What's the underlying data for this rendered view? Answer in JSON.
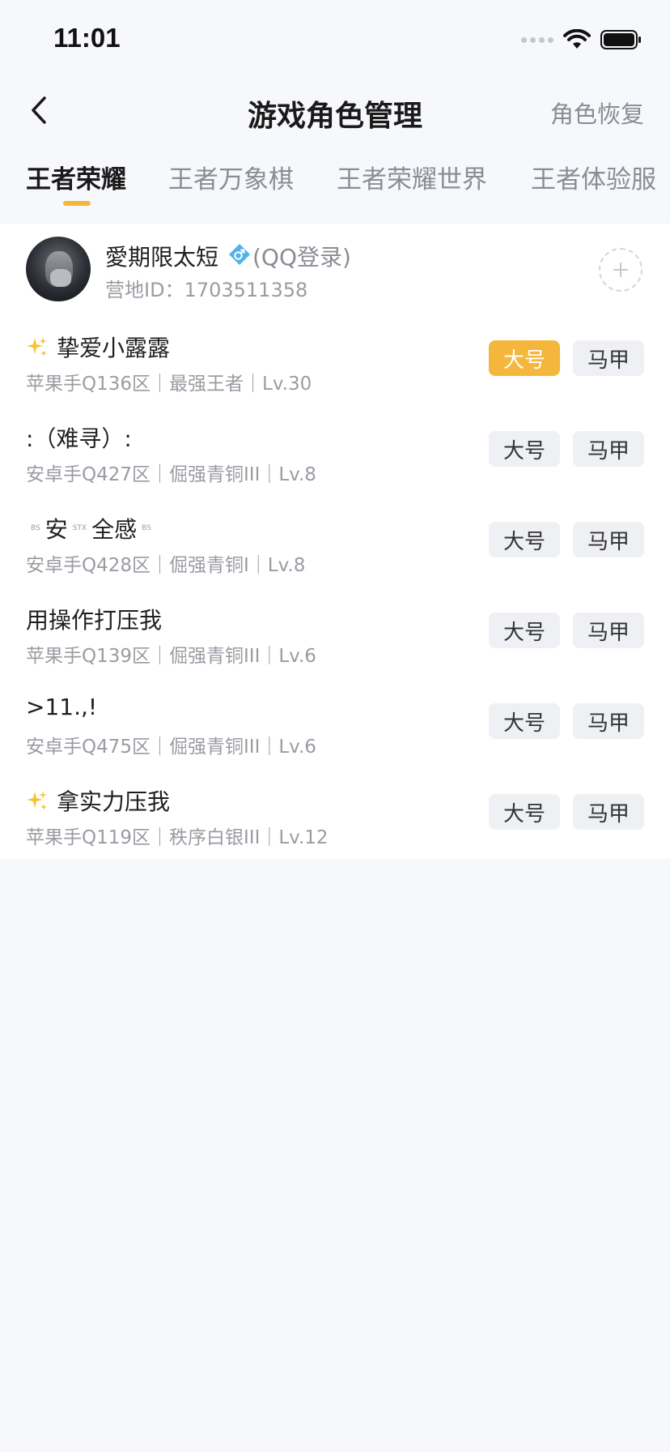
{
  "status_bar": {
    "time": "11:01",
    "icons": [
      "cellular-signal-icon",
      "wifi-icon",
      "battery-icon"
    ]
  },
  "nav": {
    "back_icon": "chevron-left-icon",
    "title": "游戏角色管理",
    "restore_label": "角色恢复"
  },
  "tabs": [
    {
      "label": "王者荣耀",
      "active": true
    },
    {
      "label": "王者万象棋",
      "active": false
    },
    {
      "label": "王者荣耀世界",
      "active": false
    },
    {
      "label": "王者体验服",
      "active": false
    }
  ],
  "colors": {
    "accent": "#f5b73b",
    "gender_blue": "#4fb3e8",
    "sparkle": "#f4c430"
  },
  "account": {
    "name": "愛期限太短",
    "gender_icon": "male-icon",
    "login_type": "(QQ登录)",
    "camp_id": "营地ID：1703511358",
    "add_icon": "plus-icon"
  },
  "roles": [
    {
      "prefix_icon": "sparkle-icon",
      "name": "挚爱小露露",
      "meta": "苹果手Q136区｜最强王者｜Lv.30",
      "main_label": "大号",
      "alt_label": "马甲",
      "main_selected": true
    },
    {
      "prefix_icon": "",
      "name": ":（难寻）:",
      "meta": "安卓手Q427区｜倔强青铜III｜Lv.8",
      "main_label": "大号",
      "alt_label": "马甲",
      "main_selected": false
    },
    {
      "prefix_icon": "",
      "name_parts": [
        "BS",
        "安",
        "STX",
        "全感",
        "BS"
      ],
      "meta": "安卓手Q428区｜倔强青铜I｜Lv.8",
      "main_label": "大号",
      "alt_label": "马甲",
      "main_selected": false
    },
    {
      "prefix_icon": "",
      "name": "用操作打压我",
      "meta": "苹果手Q139区｜倔强青铜III｜Lv.6",
      "main_label": "大号",
      "alt_label": "马甲",
      "main_selected": false
    },
    {
      "prefix_icon": "",
      "name": ">11.,!",
      "meta": "安卓手Q475区｜倔强青铜III｜Lv.6",
      "main_label": "大号",
      "alt_label": "马甲",
      "main_selected": false
    },
    {
      "prefix_icon": "sparkle-icon",
      "name": "拿实力压我",
      "meta": "苹果手Q119区｜秩序白银III｜Lv.12",
      "main_label": "大号",
      "alt_label": "马甲",
      "main_selected": false
    }
  ]
}
